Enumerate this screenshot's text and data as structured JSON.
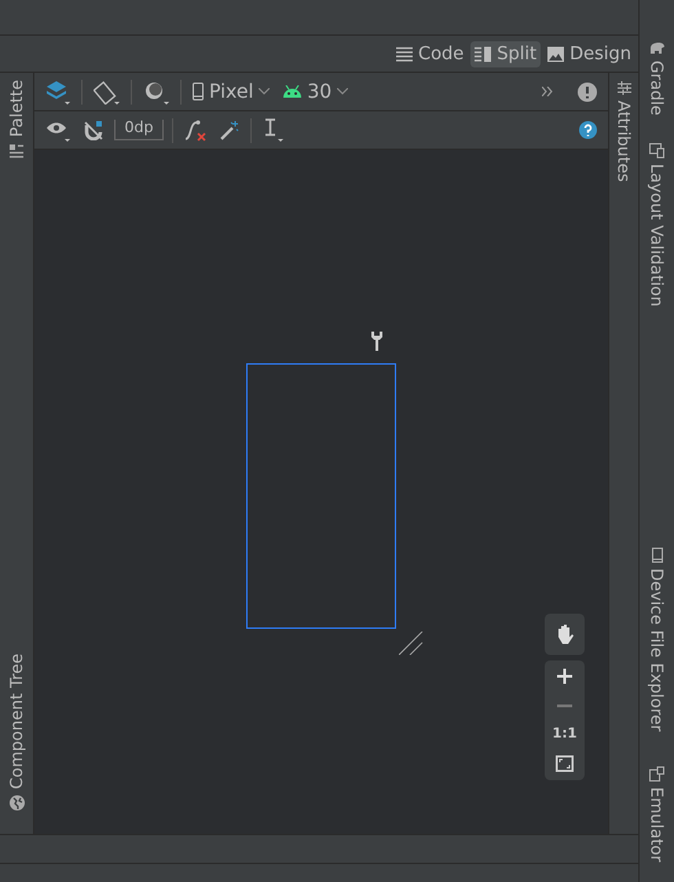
{
  "view_modes": [
    {
      "label": "Code",
      "kind": "code",
      "selected": false
    },
    {
      "label": "Split",
      "kind": "split",
      "selected": true
    },
    {
      "label": "Design",
      "kind": "design",
      "selected": false
    }
  ],
  "left_tool_tabs": [
    {
      "label": "Palette",
      "kind": "palette"
    },
    {
      "label": "Component Tree",
      "kind": "tree"
    }
  ],
  "right_tool_tabs": [
    {
      "label": "Gradle",
      "kind": "gradle"
    },
    {
      "label": "Layout Validation",
      "kind": "validation"
    },
    {
      "label": "Device File Explorer",
      "kind": "device"
    },
    {
      "label": "Emulator",
      "kind": "emulator"
    }
  ],
  "attributes_tab": {
    "label": "Attributes"
  },
  "toolbar": {
    "device": "Pixel",
    "api_level": "30",
    "margin": "0dp"
  },
  "zoom_controls": {
    "reset_label": "1:1"
  }
}
